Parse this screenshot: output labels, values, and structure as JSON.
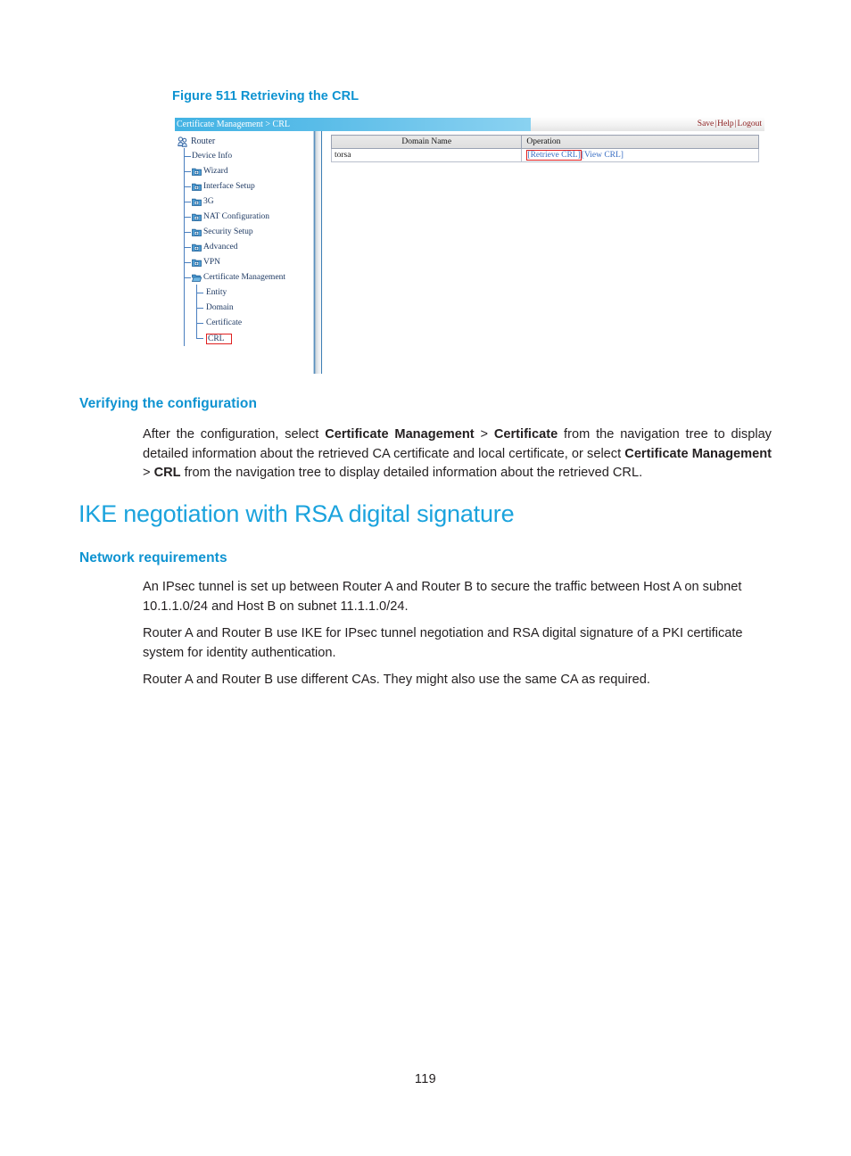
{
  "page": {
    "number": "119"
  },
  "figure": {
    "caption": "Figure 511 Retrieving the CRL"
  },
  "screenshot": {
    "breadcrumb": "Certificate Management > CRL",
    "header_links": {
      "save": "Save",
      "help": "Help",
      "logout": "Logout",
      "separator": "|"
    },
    "tree": {
      "root": {
        "label": "Router",
        "icon": "users-icon"
      },
      "items": [
        {
          "label": "Device Info",
          "icon": "none",
          "level": 1
        },
        {
          "label": "Wizard",
          "icon": "folder-closed-icon",
          "level": 1
        },
        {
          "label": "Interface Setup",
          "icon": "folder-closed-icon",
          "level": 1
        },
        {
          "label": "3G",
          "icon": "folder-closed-icon",
          "level": 1
        },
        {
          "label": "NAT Configuration",
          "icon": "folder-closed-icon",
          "level": 1
        },
        {
          "label": "Security Setup",
          "icon": "folder-closed-icon",
          "level": 1
        },
        {
          "label": "Advanced",
          "icon": "folder-closed-icon",
          "level": 1
        },
        {
          "label": "VPN",
          "icon": "folder-closed-icon",
          "level": 1
        },
        {
          "label": "Certificate Management",
          "icon": "folder-open-icon",
          "level": 1
        },
        {
          "label": "Entity",
          "icon": "none",
          "level": 2
        },
        {
          "label": "Domain",
          "icon": "none",
          "level": 2
        },
        {
          "label": "Certificate",
          "icon": "none",
          "level": 2
        },
        {
          "label": "CRL",
          "icon": "none",
          "level": 2,
          "highlighted": true
        }
      ]
    },
    "table": {
      "columns": [
        "Domain Name",
        "Operation"
      ],
      "rows": [
        {
          "domain_name": "torsa",
          "operations": [
            {
              "label": "[Retrieve CRL]",
              "highlighted": true
            },
            {
              "label": "[View CRL]",
              "highlighted": false
            }
          ]
        }
      ]
    },
    "colors": {
      "header_blue": "#59bce8",
      "link_red": "#8b1b1b",
      "highlight_red": "#e02020",
      "tree_text": "#1f3a63",
      "op_link_blue": "#3a6fc4"
    }
  },
  "sections": {
    "verifying": {
      "heading": "Verifying the configuration",
      "paragraph_parts": [
        {
          "text": "After the configuration, select ",
          "bold": false
        },
        {
          "text": "Certificate Management",
          "bold": true
        },
        {
          "text": " > ",
          "bold": false
        },
        {
          "text": "Certificate",
          "bold": true
        },
        {
          "text": " from the navigation tree to display detailed information about the retrieved CA certificate and local certificate, or select ",
          "bold": false
        },
        {
          "text": "Certificate Management",
          "bold": true
        },
        {
          "text": " > ",
          "bold": false
        },
        {
          "text": "CRL",
          "bold": true
        },
        {
          "text": " from the navigation tree to display detailed information about the retrieved CRL.",
          "bold": false
        }
      ]
    },
    "ike": {
      "heading": "IKE negotiation with RSA digital signature",
      "network_requirements": {
        "heading": "Network requirements",
        "paragraphs": [
          "An IPsec tunnel is set up between Router A and Router B to secure the traffic between Host A on subnet 10.1.1.0/24 and Host B on subnet 11.1.1.0/24.",
          "Router A and Router B use IKE for IPsec tunnel negotiation and RSA digital signature of a PKI certificate system for identity authentication.",
          "Router A and Router B use different CAs. They might also use the same CA as required."
        ]
      }
    }
  },
  "theme": {
    "heading_blue": "#0e93d1",
    "title_blue": "#1ba3dd",
    "body_text": "#231f20"
  }
}
